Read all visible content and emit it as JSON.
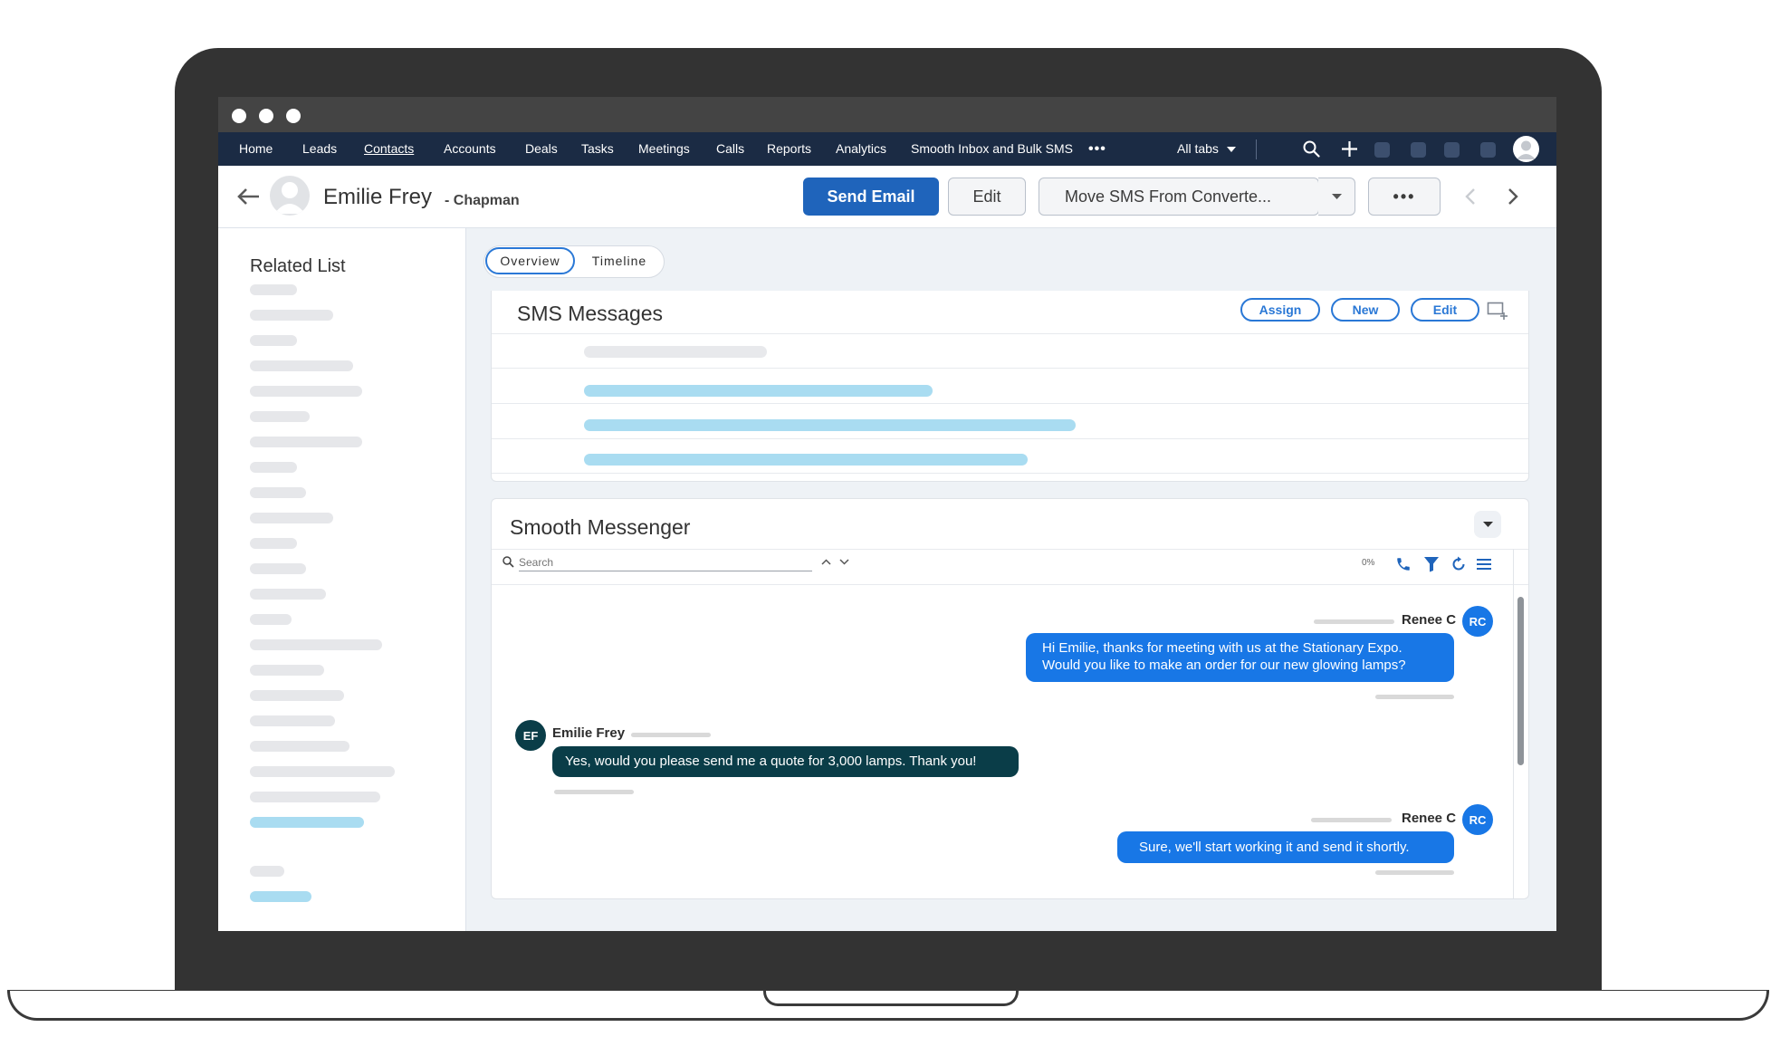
{
  "nav": {
    "items": [
      "Home",
      "Leads",
      "Contacts",
      "Accounts",
      "Deals",
      "Tasks",
      "Meetings",
      "Calls",
      "Reports",
      "Analytics",
      "Smooth Inbox and Bulk SMS"
    ],
    "more": "•••",
    "all_tabs": "All tabs"
  },
  "contact": {
    "name": "Emilie Frey",
    "company": "- Chapman"
  },
  "header": {
    "send_email": "Send Email",
    "edit": "Edit",
    "move_sms": "Move SMS From Converte...",
    "more": "•••"
  },
  "sidebar": {
    "title": "Related List"
  },
  "tabs": {
    "overview": "Overview",
    "timeline": "Timeline"
  },
  "sms_messages": {
    "title": "SMS Messages",
    "assign": "Assign",
    "new": "New",
    "edit": "Edit"
  },
  "messenger": {
    "title": "Smooth Messenger",
    "search_placeholder": "Search",
    "percent": "0%",
    "messages": [
      {
        "sender": "Renee C",
        "initials": "RC",
        "text": "Hi Emilie, thanks for meeting with us at the Stationary Expo. Would you like to make an order for our new glowing lamps?"
      },
      {
        "sender": "Emilie Frey",
        "initials": "EF",
        "text": "Yes, would you please send me a quote for 3,000 lamps. Thank you!"
      },
      {
        "sender": "Renee C",
        "initials": "RC",
        "text": "Sure, we'll start working it and send it shortly."
      }
    ]
  },
  "colors": {
    "nav_bg": "#1b2b44",
    "primary": "#1f64bb",
    "outgoing_bubble": "#1877e6",
    "incoming_bubble": "#0a3d48",
    "skeleton_blue": "#a9dcf1"
  }
}
